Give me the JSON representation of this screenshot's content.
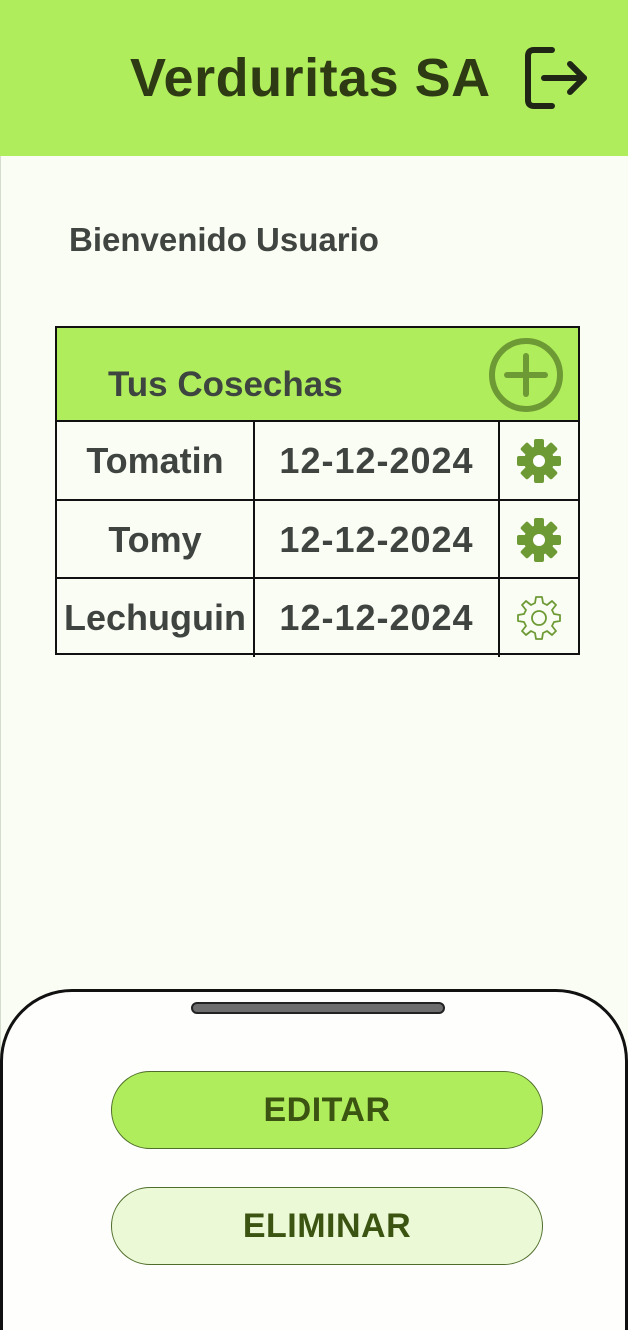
{
  "header": {
    "title": "Verduritas SA",
    "logout_icon": "logout-icon",
    "background": "#b0ed5c"
  },
  "welcome": "Bienvenido Usuario",
  "harvests": {
    "title": "Tus Cosechas",
    "add_icon": "plus-circle-icon",
    "rows": [
      {
        "name": "Tomatin",
        "date": "12-12-2024",
        "icon": "gear-filled-icon"
      },
      {
        "name": "Tomy",
        "date": "12-12-2024",
        "icon": "gear-filled-icon"
      },
      {
        "name": "Lechuguin",
        "date": "12-12-2024",
        "icon": "gear-outline-icon"
      }
    ]
  },
  "sheet": {
    "edit_label": "EDITAR",
    "delete_label": "ELIMINAR"
  },
  "colors": {
    "accent": "#b0ed5c",
    "icon_green": "#6e9a35",
    "text_dark": "#2d3a13"
  }
}
